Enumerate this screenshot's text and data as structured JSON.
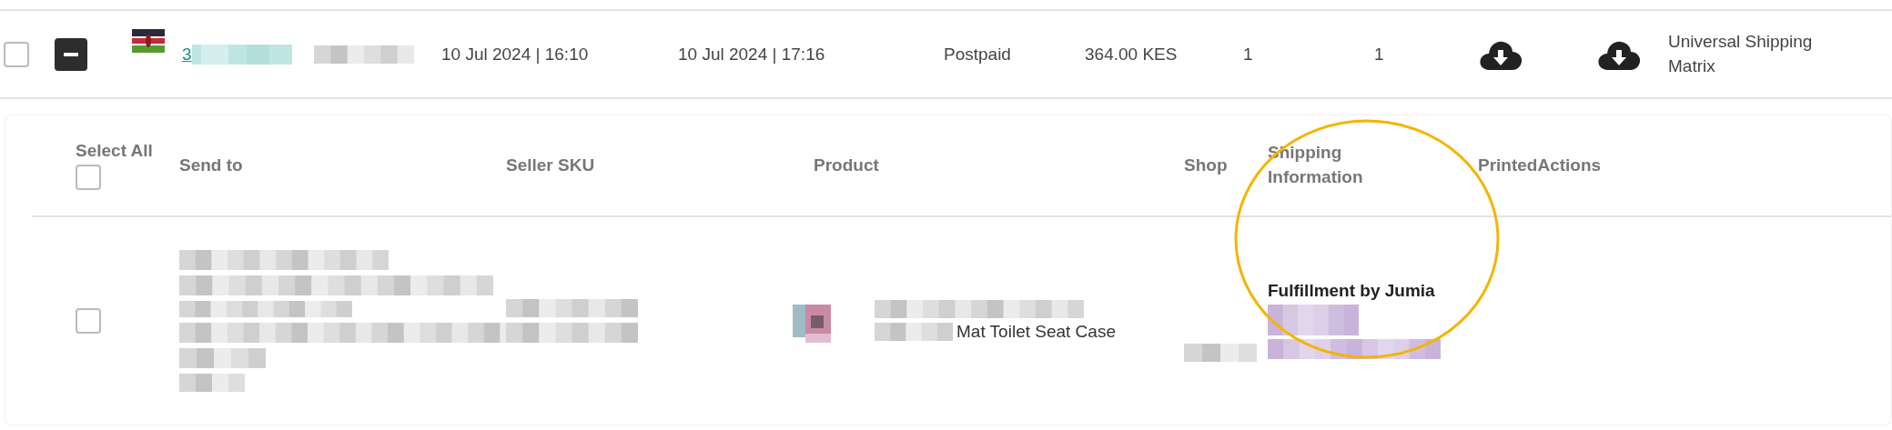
{
  "order": {
    "selected": false,
    "expanded": true,
    "number_link": "3",
    "created": "10 Jul 2024 | 16:10",
    "updated": "10 Jul 2024 | 17:16",
    "payment": "Postpaid",
    "amount": "364.00 KES",
    "column_qty_1": "1",
    "column_qty_2": "1",
    "shipping_method": "Universal Shipping Matrix"
  },
  "items_table": {
    "select_all": {
      "label": "Select All",
      "checked": false
    },
    "columns": [
      "Send to",
      "Seller SKU",
      "Product",
      "Shop",
      "Shipping Information",
      "Printed",
      "Actions"
    ],
    "rows": [
      {
        "selected": false,
        "product_name": "Mat Toilet Seat Case",
        "shipping": "Fulfillment by Jumia"
      }
    ]
  },
  "annotation": {
    "kind": "ellipse",
    "color": "#f4b400"
  }
}
